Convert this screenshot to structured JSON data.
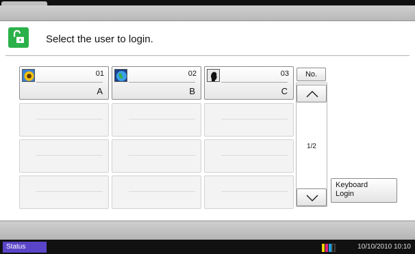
{
  "header": {
    "prompt": "Select the user to login.",
    "lock_icon": "unlocked-padlock-icon"
  },
  "users": [
    {
      "number": "01",
      "name": "A",
      "avatar": "sunflower-icon"
    },
    {
      "number": "02",
      "name": "B",
      "avatar": "globe-icon"
    },
    {
      "number": "03",
      "name": "C",
      "avatar": "silhouette-icon"
    }
  ],
  "sidebar": {
    "no_label": "No.",
    "page_indicator": "1/2",
    "up_icon": "chevron-up-icon",
    "down_icon": "chevron-down-icon",
    "keyboard_login_line1": "Keyboard",
    "keyboard_login_line2": "Login"
  },
  "statusbar": {
    "status_label": "Status",
    "datetime": "10/10/2010  10:10",
    "toner_icon": "toner-level-icon"
  },
  "colors": {
    "accent_green": "#2bb14a",
    "status_purple": "#5a45c8"
  }
}
